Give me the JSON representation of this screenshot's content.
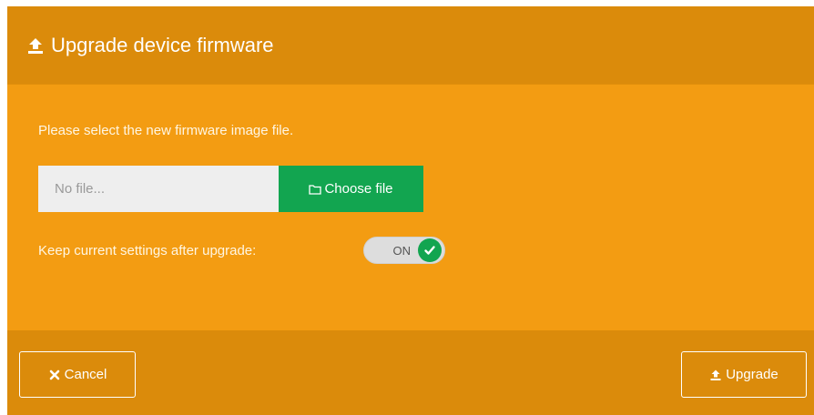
{
  "dialog": {
    "title": "Upgrade device firmware",
    "title_icon": "upload-icon",
    "instruction": "Please select the new firmware image file.",
    "file_input": {
      "value": "",
      "placeholder": "No file..."
    },
    "choose_file_label": "Choose file",
    "choose_file_icon": "folder-icon",
    "keep_settings_label": "Keep current settings after upgrade:",
    "keep_settings_toggle": {
      "state_label": "ON",
      "checked": true
    },
    "cancel_label": "Cancel",
    "cancel_icon": "close-icon",
    "upgrade_label": "Upgrade",
    "upgrade_icon": "upload-icon"
  },
  "colors": {
    "header_bg": "#db8b0b",
    "body_bg": "#f39c12",
    "footer_bg": "#db8b0b",
    "choose_button_bg": "#12a550",
    "toggle_knob": "#12a550",
    "input_bg": "#eeeeee",
    "text_light": "#fff6e3"
  }
}
